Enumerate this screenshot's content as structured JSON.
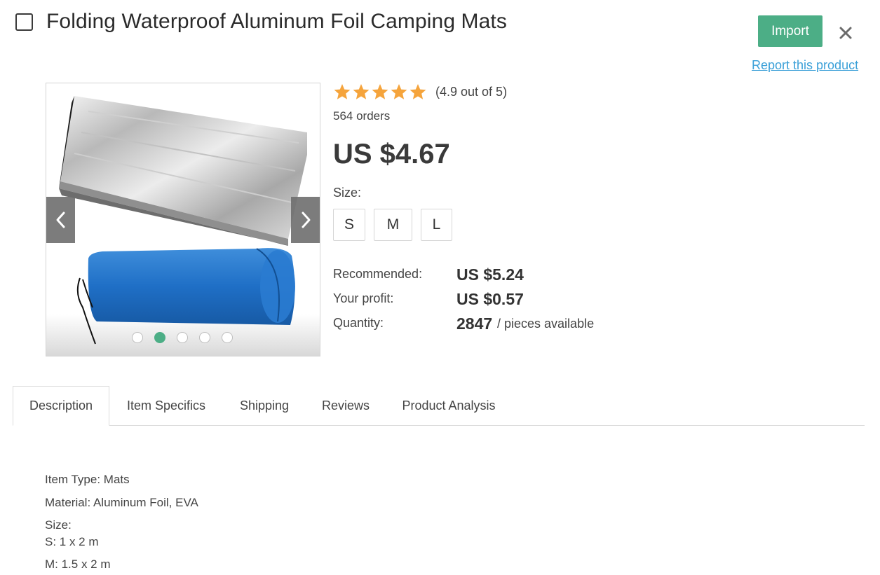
{
  "product": {
    "title": "Folding Waterproof Aluminum Foil Camping Mats",
    "import_label": "Import",
    "report_label": "Report this product",
    "rating_value": 4.9,
    "rating_text": "(4.9 out of 5)",
    "orders": "564 orders",
    "price": "US $4.67",
    "size_label": "Size:",
    "sizes": [
      "S",
      "M",
      "L"
    ],
    "recommended_label": "Recommended:",
    "recommended_value": "US $5.24",
    "profit_label": "Your profit:",
    "profit_value": "US $0.57",
    "quantity_label": "Quantity:",
    "quantity_value": "2847",
    "quantity_suffix": "/ pieces available"
  },
  "gallery": {
    "slide_count": 5,
    "active_slide": 2
  },
  "tabs": [
    {
      "label": "Description",
      "active": true
    },
    {
      "label": "Item Specifics",
      "active": false
    },
    {
      "label": "Shipping",
      "active": false
    },
    {
      "label": "Reviews",
      "active": false
    },
    {
      "label": "Product Analysis",
      "active": false
    }
  ],
  "description": {
    "lines": [
      "Item Type: Mats",
      "Material: Aluminum Foil, EVA",
      "Size:",
      "S: 1 x 2 m",
      "M: 1.5 x 2 m"
    ]
  },
  "colors": {
    "accent": "#4cae86",
    "link": "#3ba0d8",
    "star": "#f5a43c"
  }
}
